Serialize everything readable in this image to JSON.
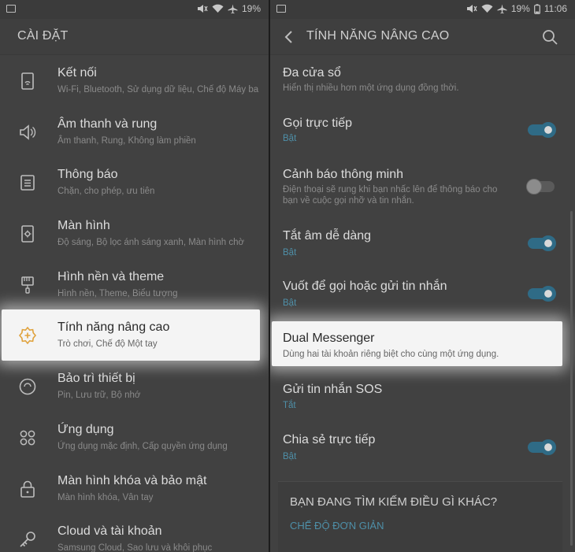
{
  "status_bar": {
    "battery": "19%",
    "time": "11:06"
  },
  "left_panel": {
    "title": "CÀI ĐẶT",
    "items": [
      {
        "icon": "connections-icon",
        "title": "Kết nối",
        "subtitle": "Wi-Fi, Bluetooth, Sử dụng dữ liệu, Chế độ Máy ba",
        "highlighted": false
      },
      {
        "icon": "sound-icon",
        "title": "Âm thanh và rung",
        "subtitle": "Âm thanh, Rung, Không làm phiền",
        "highlighted": false
      },
      {
        "icon": "notifications-icon",
        "title": "Thông báo",
        "subtitle": "Chặn, cho phép, ưu tiên",
        "highlighted": false
      },
      {
        "icon": "display-icon",
        "title": "Màn hình",
        "subtitle": "Độ sáng, Bộ lọc ánh sáng xanh, Màn hình chờ",
        "highlighted": false
      },
      {
        "icon": "wallpaper-icon",
        "title": "Hình nền và theme",
        "subtitle": "Hình nền, Theme, Biểu tượng",
        "highlighted": false
      },
      {
        "icon": "advanced-features-icon",
        "title": "Tính năng nâng cao",
        "subtitle": "Trò chơi, Chế độ Một tay",
        "highlighted": true
      },
      {
        "icon": "device-maintenance-icon",
        "title": "Bảo trì thiết bị",
        "subtitle": "Pin, Lưu trữ, Bộ nhớ",
        "highlighted": false
      },
      {
        "icon": "apps-icon",
        "title": "Ứng dụng",
        "subtitle": "Ứng dụng mặc định, Cấp quyền ứng dụng",
        "highlighted": false
      },
      {
        "icon": "lock-icon",
        "title": "Màn hình khóa và bảo mật",
        "subtitle": "Màn hình khóa, Vân tay",
        "highlighted": false
      },
      {
        "icon": "key-icon",
        "title": "Cloud và tài khoản",
        "subtitle": "Samsung Cloud, Sao lưu và khôi phục",
        "highlighted": false
      }
    ]
  },
  "right_panel": {
    "title": "TÍNH NĂNG NÂNG CAO",
    "items": [
      {
        "title": "Đa cửa sổ",
        "subtitle": "Hiển thị nhiều hơn một ứng dụng đồng thời.",
        "toggle": null
      },
      {
        "title": "Gọi trực tiếp",
        "subtitle": "Bật",
        "toggle": "on"
      },
      {
        "title": "Cảnh báo thông minh",
        "subtitle": "Điện thoại sẽ rung khi bạn nhấc lên để thông báo cho bạn về cuộc gọi nhỡ và tin nhắn.",
        "toggle": "off"
      },
      {
        "title": "Tắt âm dễ dàng",
        "subtitle": "Bật",
        "toggle": "on"
      },
      {
        "title": "Vuốt để gọi hoặc gửi tin nhắn",
        "subtitle": "Bật",
        "toggle": "on"
      },
      {
        "title": "Dual Messenger",
        "subtitle": "Dùng hai tài khoản riêng biệt cho cùng một ứng dụng.",
        "toggle": null
      },
      {
        "title": "Gửi tin nhắn SOS",
        "subtitle": "Tắt",
        "toggle": null
      },
      {
        "title": "Chia sẻ trực tiếp",
        "subtitle": "Bật",
        "toggle": "on"
      }
    ],
    "card": {
      "question": "BẠN ĐANG TÌM KIẾM ĐIỀU GÌ KHÁC?",
      "link": "CHẾ ĐỘ ĐƠN GIẢN"
    }
  },
  "colors": {
    "accent": "#4e8fa8",
    "toggle_on": "#2f6b86",
    "highlight_icon": "#e0a23c"
  }
}
